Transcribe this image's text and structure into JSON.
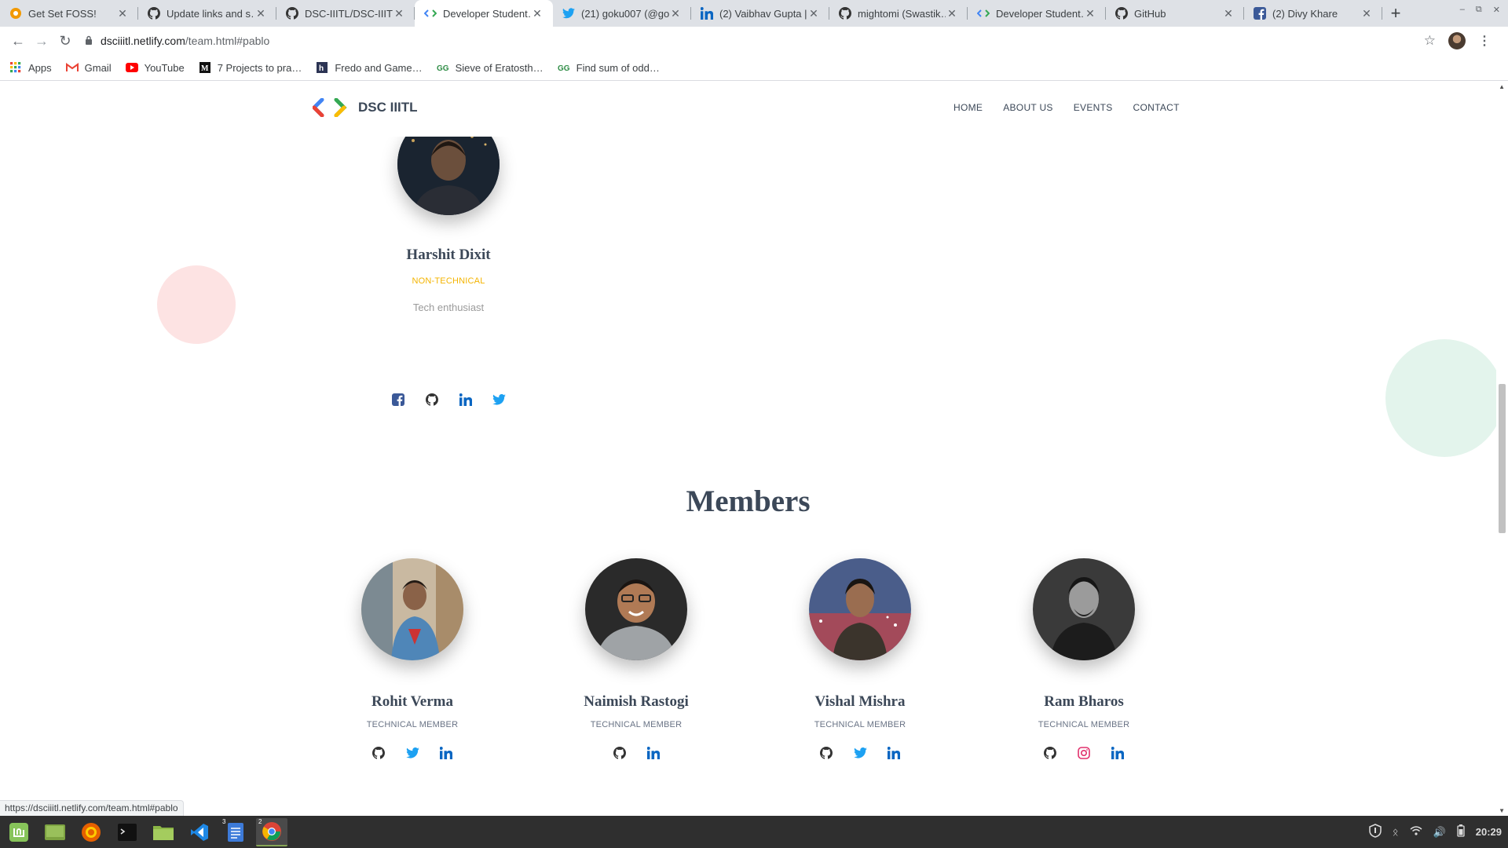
{
  "browser": {
    "tabs": [
      {
        "title": "Get Set FOSS!",
        "icon": "chrome-tab-icon",
        "active": false
      },
      {
        "title": "Update links and s…",
        "icon": "github-icon",
        "active": false
      },
      {
        "title": "DSC-IIITL/DSC-IIITL…",
        "icon": "github-icon",
        "active": false
      },
      {
        "title": "Developer Student…",
        "icon": "dsc-icon",
        "active": true
      },
      {
        "title": "(21) goku007 (@go…",
        "icon": "twitter-icon",
        "active": false
      },
      {
        "title": "(2) Vaibhav Gupta |…",
        "icon": "linkedin-icon",
        "active": false
      },
      {
        "title": "mightomi (Swastik…",
        "icon": "github-icon",
        "active": false
      },
      {
        "title": "Developer Student…",
        "icon": "dsc-icon",
        "active": false
      },
      {
        "title": "GitHub",
        "icon": "github-icon",
        "active": false
      },
      {
        "title": "(2) Divy Khare",
        "icon": "facebook-icon",
        "active": false
      }
    ],
    "new_tab": "+",
    "url_host": "dsciiitl.netlify.com",
    "url_path": "/team.html#pablo",
    "bookmarks": [
      {
        "label": "Apps",
        "icon": "apps-grid-icon"
      },
      {
        "label": "Gmail",
        "icon": "gmail-icon"
      },
      {
        "label": "YouTube",
        "icon": "youtube-icon"
      },
      {
        "label": "7 Projects to pra…",
        "icon": "medium-icon"
      },
      {
        "label": "Fredo and Game…",
        "icon": "hackerearth-icon"
      },
      {
        "label": "Sieve of Eratosth…",
        "icon": "geeksforgeeks-icon"
      },
      {
        "label": "Find sum of odd…",
        "icon": "geeksforgeeks-icon"
      }
    ],
    "status_url": "https://dsciiitl.netlify.com/team.html#pablo"
  },
  "site": {
    "brand": "DSC IIITL",
    "nav": [
      "HOME",
      "ABOUT US",
      "EVENTS",
      "CONTACT"
    ],
    "lead": {
      "name": "Harshit Dixit",
      "role": "NON-TECHNICAL",
      "bio": "Tech enthusiast",
      "socials": [
        "facebook-icon",
        "github-icon",
        "linkedin-icon",
        "twitter-icon"
      ]
    },
    "members_title": "Members",
    "members": [
      {
        "name": "Rohit Verma",
        "role": "TECHNICAL MEMBER",
        "socials": [
          "github-icon",
          "twitter-icon",
          "linkedin-icon"
        ]
      },
      {
        "name": "Naimish Rastogi",
        "role": "TECHNICAL MEMBER",
        "socials": [
          "github-icon",
          "linkedin-icon"
        ]
      },
      {
        "name": "Vishal Mishra",
        "role": "TECHNICAL MEMBER",
        "socials": [
          "github-icon",
          "twitter-icon",
          "linkedin-icon"
        ]
      },
      {
        "name": "Ram Bharos",
        "role": "TECHNICAL MEMBER",
        "socials": [
          "github-icon",
          "instagram-icon",
          "linkedin-icon"
        ]
      }
    ]
  },
  "os": {
    "clock": "20:29",
    "badges": {
      "editor": "3",
      "chrome": "2"
    }
  },
  "colors": {
    "role_accent": "#f4b400",
    "facebook": "#3b5998",
    "twitter": "#1da1f2",
    "linkedin": "#0a66c2",
    "instagram": "#e1306c",
    "github": "#333333"
  }
}
